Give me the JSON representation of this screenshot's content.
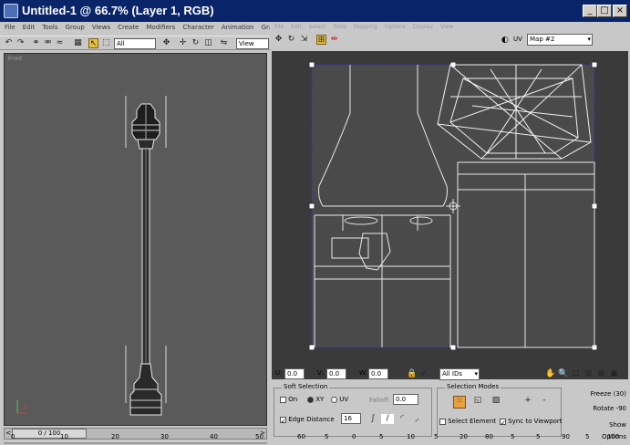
{
  "window": {
    "title": "Untitled-1 @ 66.7% (Layer 1, RGB)",
    "minimize_label": "_",
    "maximize_label": "□",
    "close_label": "×"
  },
  "max": {
    "menus": [
      "File",
      "Edit",
      "Tools",
      "Group",
      "Views",
      "Create",
      "Modifiers",
      "Character",
      "Animation",
      "Graph E"
    ],
    "toolbar": {
      "selection_set_value": "All",
      "view_dropdown_value": "View"
    },
    "viewport_label": "Front",
    "time_slider": {
      "label": "0 / 100",
      "prev_label": "<",
      "next_label": ">",
      "ticks": [
        "0",
        "10",
        "20",
        "30",
        "40",
        "50"
      ]
    },
    "axis": {
      "z": "Z",
      "x": "X"
    }
  },
  "uv_editor": {
    "menus": [
      "File",
      "Edit",
      "Select",
      "Tools",
      "Mapping",
      "Options",
      "Display",
      "View"
    ],
    "map_label": "UV",
    "map_value": "Map #2",
    "bottom": {
      "u_label": "U:",
      "v_label": "V:",
      "w_label": "W:",
      "u_value": "0.0",
      "v_value": "0.0",
      "w_value": "0.0",
      "ids_value": "All IDs"
    },
    "ruler": [
      "60",
      "5",
      "0",
      "5",
      "10",
      "5",
      "20",
      "80",
      "5",
      "5",
      "90",
      "5",
      "100"
    ],
    "soft_selection": {
      "title": "Soft Selection",
      "on_label": "On",
      "xy_label": "XY",
      "uv_label": "UV",
      "falloff_label": "Falloff:",
      "falloff_value": "0.0",
      "edge_distance_label": "Edge Distance",
      "edge_distance_value": "16"
    },
    "selection_modes": {
      "title": "Selection Modes",
      "select_element_label": "Select Element",
      "sync_label": "Sync to Viewport",
      "plus_label": "+",
      "minus_label": "-"
    },
    "side_buttons": [
      "Freeze (30)",
      "Rotate -90",
      "Show Options"
    ]
  }
}
